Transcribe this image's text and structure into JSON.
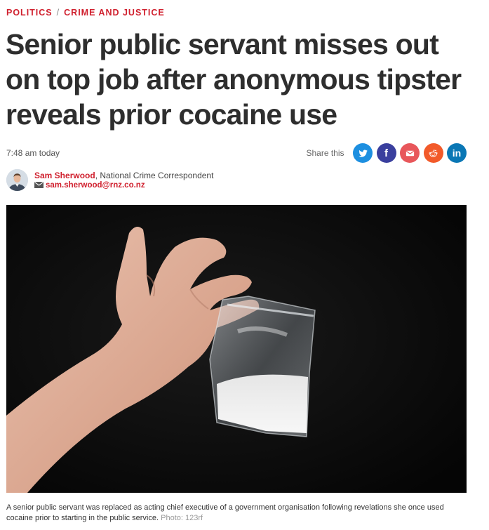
{
  "breadcrumb": {
    "section": "POLITICS",
    "separator": "/",
    "subsection": "CRIME AND JUSTICE"
  },
  "article": {
    "headline": "Senior public servant misses out on top job after anonymous tipster reveals prior cocaine use",
    "timestamp": "7:48 am today"
  },
  "share": {
    "label": "Share this",
    "buttons": [
      {
        "name": "twitter",
        "icon": "twitter-icon",
        "color": "#1d8fe0"
      },
      {
        "name": "facebook",
        "icon": "facebook-icon",
        "color": "#3a3f9e"
      },
      {
        "name": "email",
        "icon": "email-icon",
        "color": "#e8575b"
      },
      {
        "name": "reddit",
        "icon": "reddit-icon",
        "color": "#f25a2a"
      },
      {
        "name": "linkedin",
        "icon": "linkedin-icon",
        "color": "#0a77b5"
      }
    ]
  },
  "author": {
    "name": "Sam Sherwood",
    "role": ", National Crime Correspondent",
    "email": "sam.sherwood@rnz.co.nz",
    "avatar_icon": "author-avatar"
  },
  "image": {
    "caption": "A senior public servant was replaced as acting chief executive of a government organisation following revelations she once used cocaine prior to starting in the public service.",
    "credit": "Photo: 123rf"
  },
  "colors": {
    "accent": "#d0202e",
    "headline": "#2e2e2e",
    "photo_background": "#0a0a0a"
  }
}
